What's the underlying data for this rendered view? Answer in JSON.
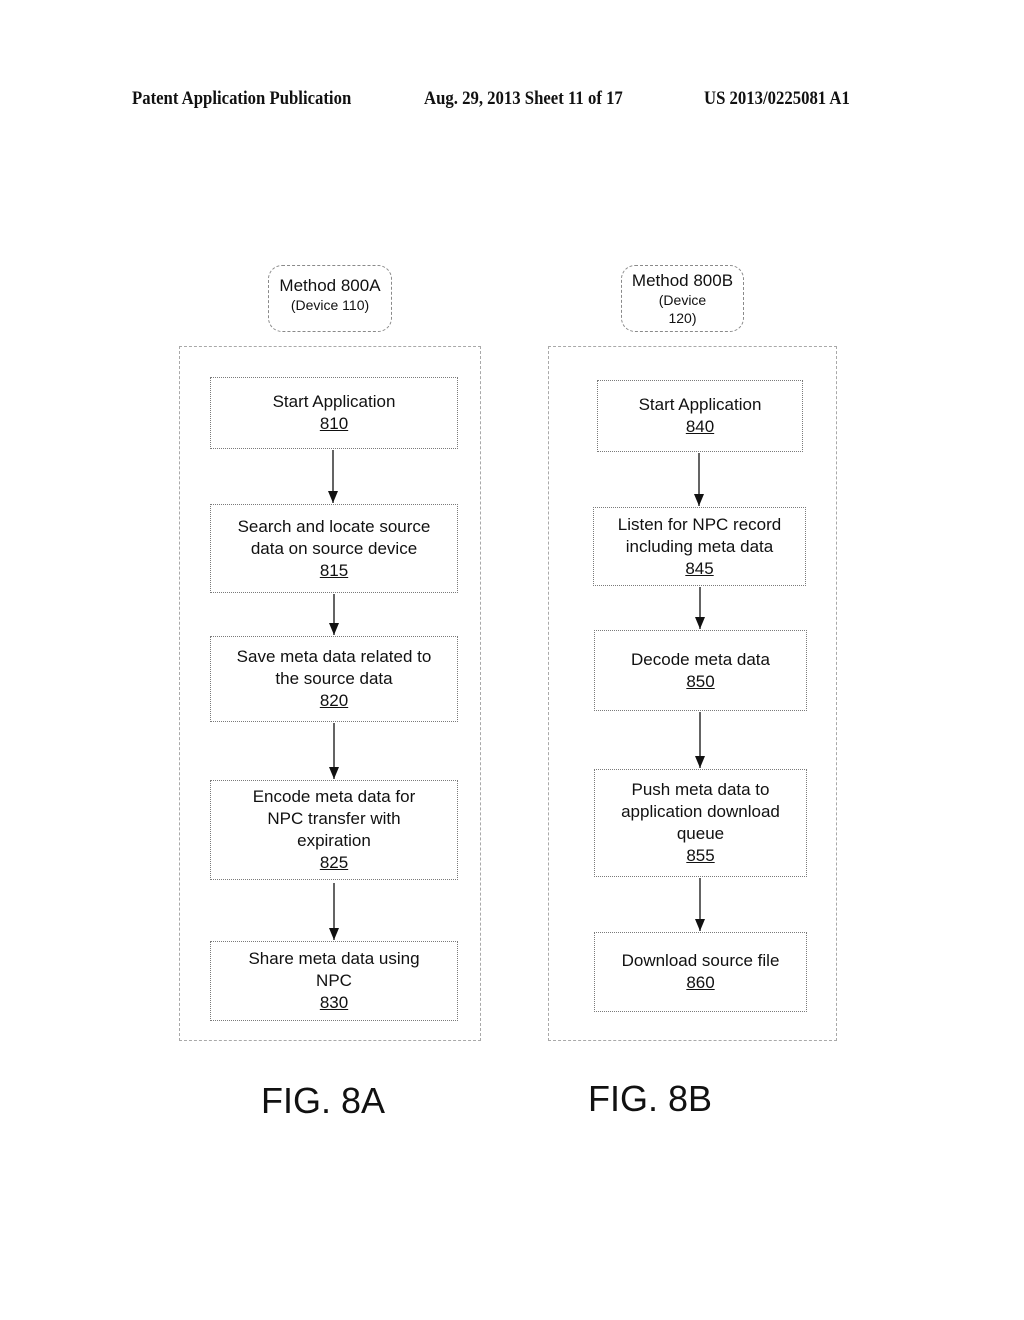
{
  "header": {
    "publication": "Patent Application Publication",
    "date_sheet": "Aug. 29, 2013  Sheet 11 of 17",
    "patent_number": "US 2013/0225081 A1"
  },
  "methods": [
    {
      "title": "Method 800A",
      "device": "(Device 110)",
      "figure": "FIG. 8A",
      "steps": [
        {
          "label": "Start Application",
          "number": "810"
        },
        {
          "label": "Search and locate source\ndata on source device",
          "number": "815"
        },
        {
          "label": "Save meta data related to\nthe source data",
          "number": "820"
        },
        {
          "label": "Encode meta data for\nNPC transfer with\nexpiration",
          "number": "825"
        },
        {
          "label": "Share meta data using\nNPC",
          "number": "830"
        }
      ]
    },
    {
      "title": "Method 800B",
      "device": "(Device\n120)",
      "figure": "FIG. 8B",
      "steps": [
        {
          "label": "Start Application",
          "number": "840"
        },
        {
          "label": "Listen for NPC record\nincluding meta data",
          "number": "845"
        },
        {
          "label": "Decode meta data",
          "number": "850"
        },
        {
          "label": "Push meta data to\napplication download\nqueue",
          "number": "855"
        },
        {
          "label": "Download source file",
          "number": "860"
        }
      ]
    }
  ]
}
